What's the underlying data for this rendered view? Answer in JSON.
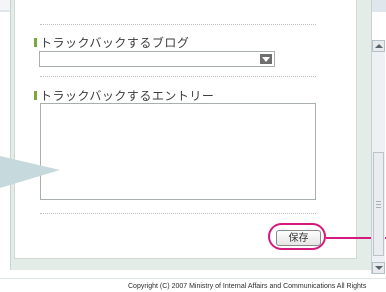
{
  "trackback_blog": {
    "label": "トラックバックするブログ",
    "selected_value": ""
  },
  "trackback_entry": {
    "label": "トラックバックするエントリー",
    "value": ""
  },
  "actions": {
    "save_label": "保存"
  },
  "footer": {
    "copyright": "Copyright (C) 2007 Ministry of Internal Affairs and Communications All Rights"
  },
  "colors": {
    "highlight": "#d41a7c",
    "section_marker": "#7aa83b",
    "panel_background": "#e3ece6"
  }
}
